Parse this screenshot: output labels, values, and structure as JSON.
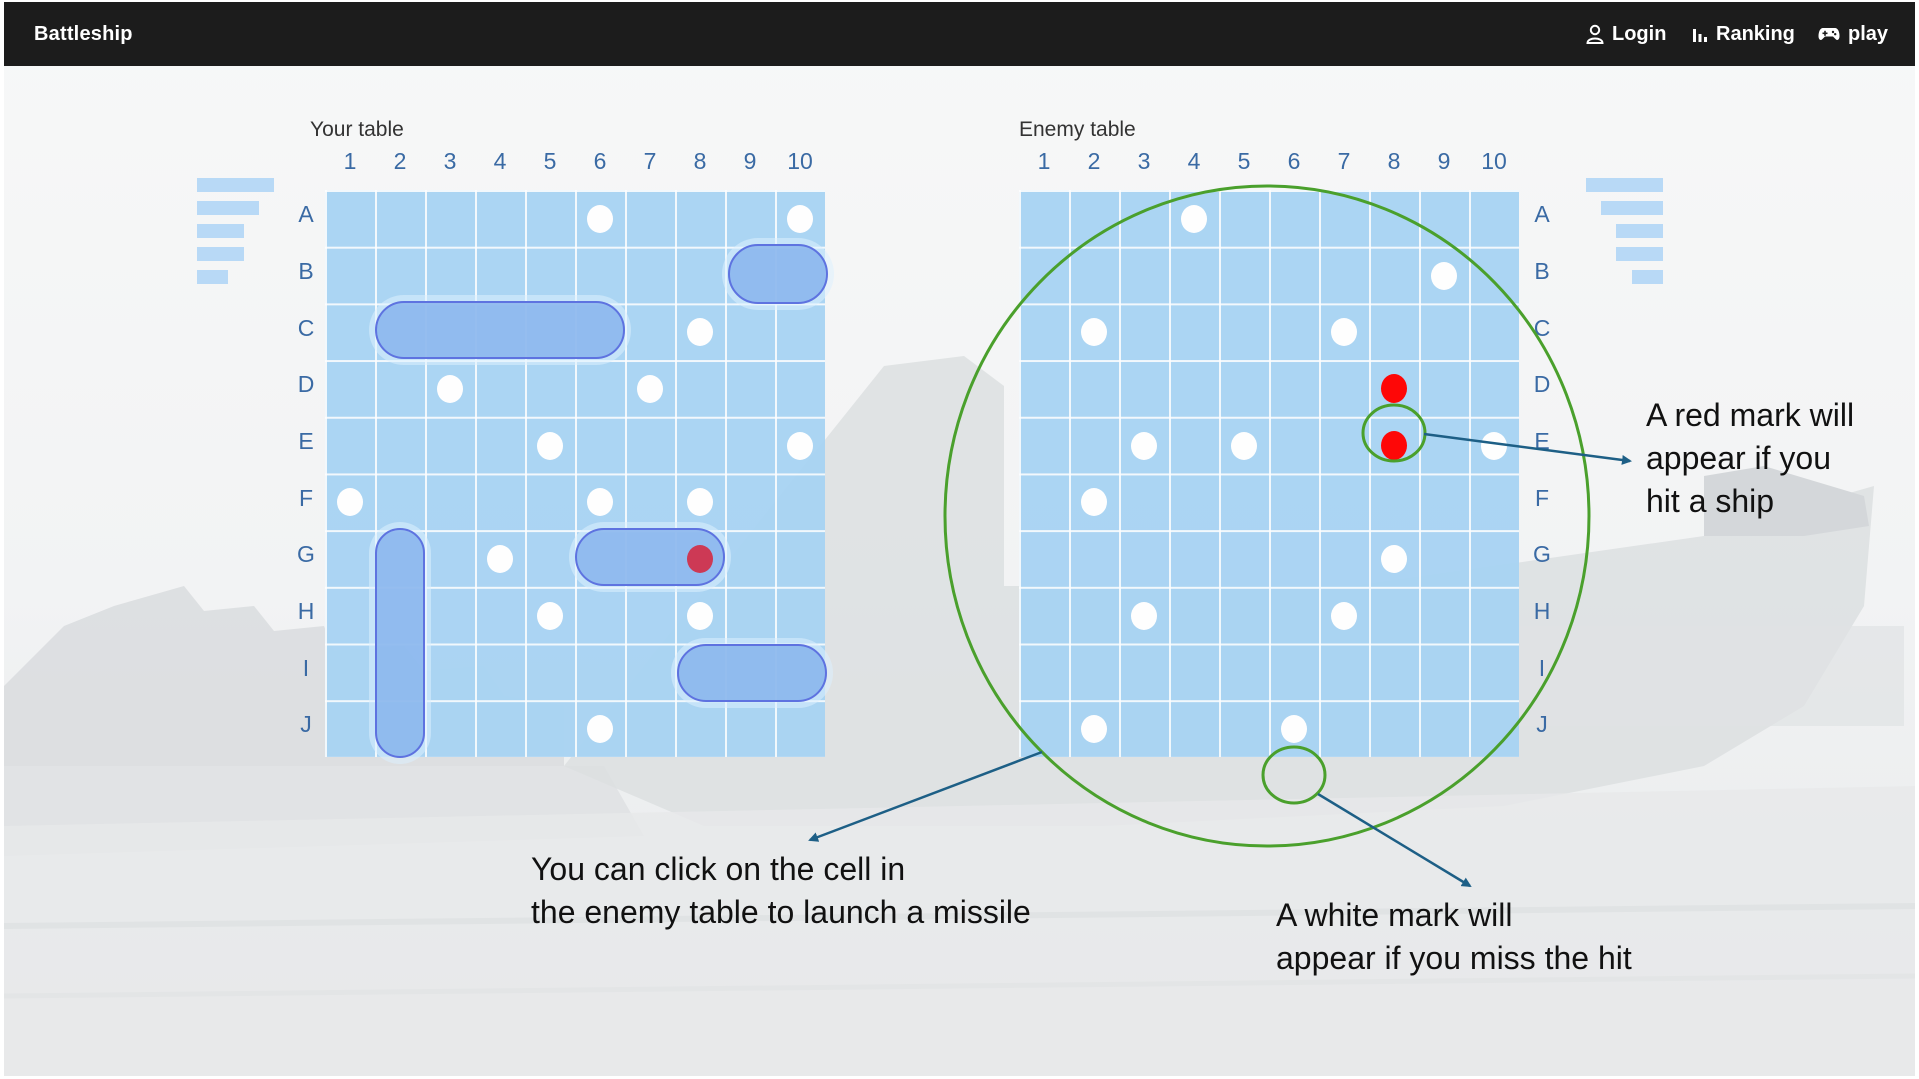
{
  "app": {
    "brand": "Battleship",
    "nav": [
      {
        "label": "Login",
        "icon": "user-icon"
      },
      {
        "label": "Ranking",
        "icon": "bar-chart-icon"
      },
      {
        "label": "play",
        "icon": "gamepad-icon"
      }
    ]
  },
  "colors": {
    "navbar": "#1c1c1c",
    "grid": "#a9d4f3",
    "ship": "#8cb8ee",
    "hit_red": "#ff0000",
    "annotation_circle": "#4aa02c",
    "arrow": "#1d5f86"
  },
  "your_table": {
    "title": "Your table",
    "columns": [
      "1",
      "2",
      "3",
      "4",
      "5",
      "6",
      "7",
      "8",
      "9",
      "10"
    ],
    "rows": [
      "A",
      "B",
      "C",
      "D",
      "E",
      "F",
      "G",
      "H",
      "I",
      "J"
    ]
  },
  "enemy_table": {
    "title": "Enemy table",
    "columns": [
      "1",
      "2",
      "3",
      "4",
      "5",
      "6",
      "7",
      "8",
      "9",
      "10"
    ],
    "rows": [
      "A",
      "B",
      "C",
      "D",
      "E",
      "F",
      "G",
      "H",
      "I",
      "J"
    ]
  },
  "annotations": {
    "red_mark": [
      "A red mark will",
      "appear if you",
      "hit a ship"
    ],
    "click_cell": [
      "You can click on the cell in",
      "the enemy table to launch a missile"
    ],
    "white_mark": [
      "A white mark will",
      "appear if you miss the hit"
    ]
  }
}
